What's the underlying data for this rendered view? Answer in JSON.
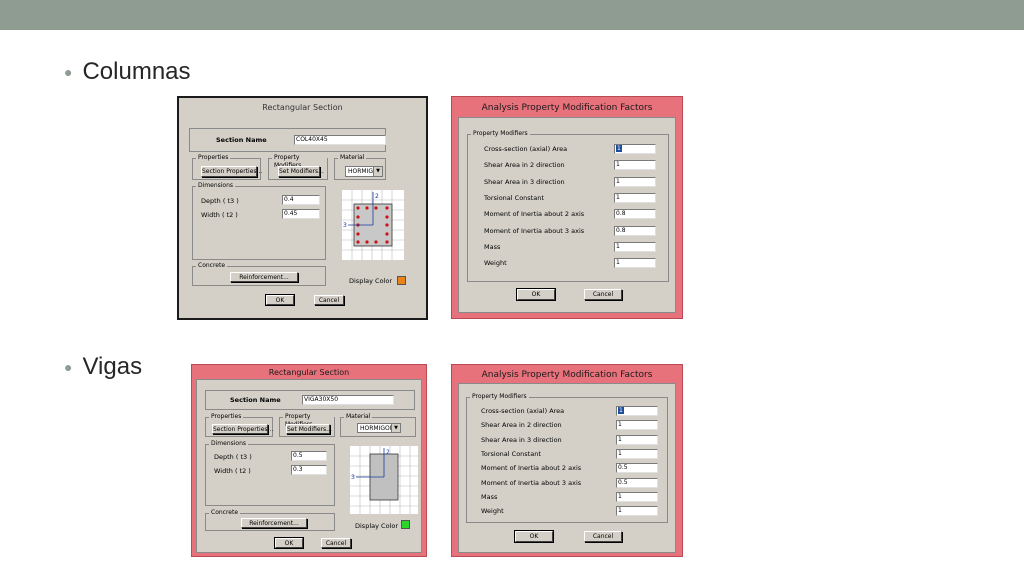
{
  "slide": {
    "bullet_columnas": "Columnas",
    "bullet_vigas": "Vigas"
  },
  "colors": {
    "topbar": "#8e9c92",
    "dialog_gray": "#d4d0c8",
    "title_pink": "#e7727c",
    "rebar_red": "#cc1111",
    "display_color_column": "#e8821c",
    "display_color_beam": "#2bd62b"
  },
  "column_section": {
    "title": "Rectangular Section",
    "section_name_label": "Section Name",
    "section_name_value": "COL40X45",
    "properties_label": "Properties",
    "section_properties_button": "Section Properties...",
    "property_modifiers_label": "Property Modifiers",
    "set_modifiers_button": "Set Modifiers...",
    "material_label": "Material",
    "material_value": "HORMIGON",
    "dimensions_label": "Dimensions",
    "depth_label": "Depth ( t3 )",
    "depth_value": "0.4",
    "width_label": "Width ( t2 )",
    "width_value": "0.45",
    "concrete_label": "Concrete",
    "reinforcement_button": "Reinforcement...",
    "display_color_label": "Display Color",
    "ok_button": "OK",
    "cancel_button": "Cancel",
    "axis_2": "2",
    "axis_3": "3"
  },
  "column_modifiers": {
    "title": "Analysis Property Modification Factors",
    "group_label": "Property Modifiers",
    "rows": [
      {
        "label": "Cross-section (axial) Area",
        "value": "1"
      },
      {
        "label": "Shear Area in 2 direction",
        "value": "1"
      },
      {
        "label": "Shear Area in 3 direction",
        "value": "1"
      },
      {
        "label": "Torsional Constant",
        "value": "1"
      },
      {
        "label": "Moment of Inertia about 2 axis",
        "value": "0.8"
      },
      {
        "label": "Moment of Inertia about 3 axis",
        "value": "0.8"
      },
      {
        "label": "Mass",
        "value": "1"
      },
      {
        "label": "Weight",
        "value": "1"
      }
    ],
    "ok_button": "OK",
    "cancel_button": "Cancel"
  },
  "beam_section": {
    "title": "Rectangular Section",
    "section_name_label": "Section Name",
    "section_name_value": "VIGA30X50",
    "properties_label": "Properties",
    "section_properties_button": "Section Properties...",
    "property_modifiers_label": "Property Modifiers",
    "set_modifiers_button": "Set Modifiers...",
    "material_label": "Material",
    "material_value": "HORMIGON",
    "dimensions_label": "Dimensions",
    "depth_label": "Depth ( t3 )",
    "depth_value": "0.5",
    "width_label": "Width ( t2 )",
    "width_value": "0.3",
    "concrete_label": "Concrete",
    "reinforcement_button": "Reinforcement...",
    "display_color_label": "Display Color",
    "ok_button": "OK",
    "cancel_button": "Cancel",
    "axis_2": "2",
    "axis_3": "3"
  },
  "beam_modifiers": {
    "title": "Analysis Property Modification Factors",
    "group_label": "Property Modifiers",
    "rows": [
      {
        "label": "Cross-section (axial) Area",
        "value": "1"
      },
      {
        "label": "Shear Area in 2 direction",
        "value": "1"
      },
      {
        "label": "Shear Area in 3 direction",
        "value": "1"
      },
      {
        "label": "Torsional Constant",
        "value": "1"
      },
      {
        "label": "Moment of Inertia about 2 axis",
        "value": "0.5"
      },
      {
        "label": "Moment of Inertia about 3 axis",
        "value": "0.5"
      },
      {
        "label": "Mass",
        "value": "1"
      },
      {
        "label": "Weight",
        "value": "1"
      }
    ],
    "ok_button": "OK",
    "cancel_button": "Cancel"
  }
}
